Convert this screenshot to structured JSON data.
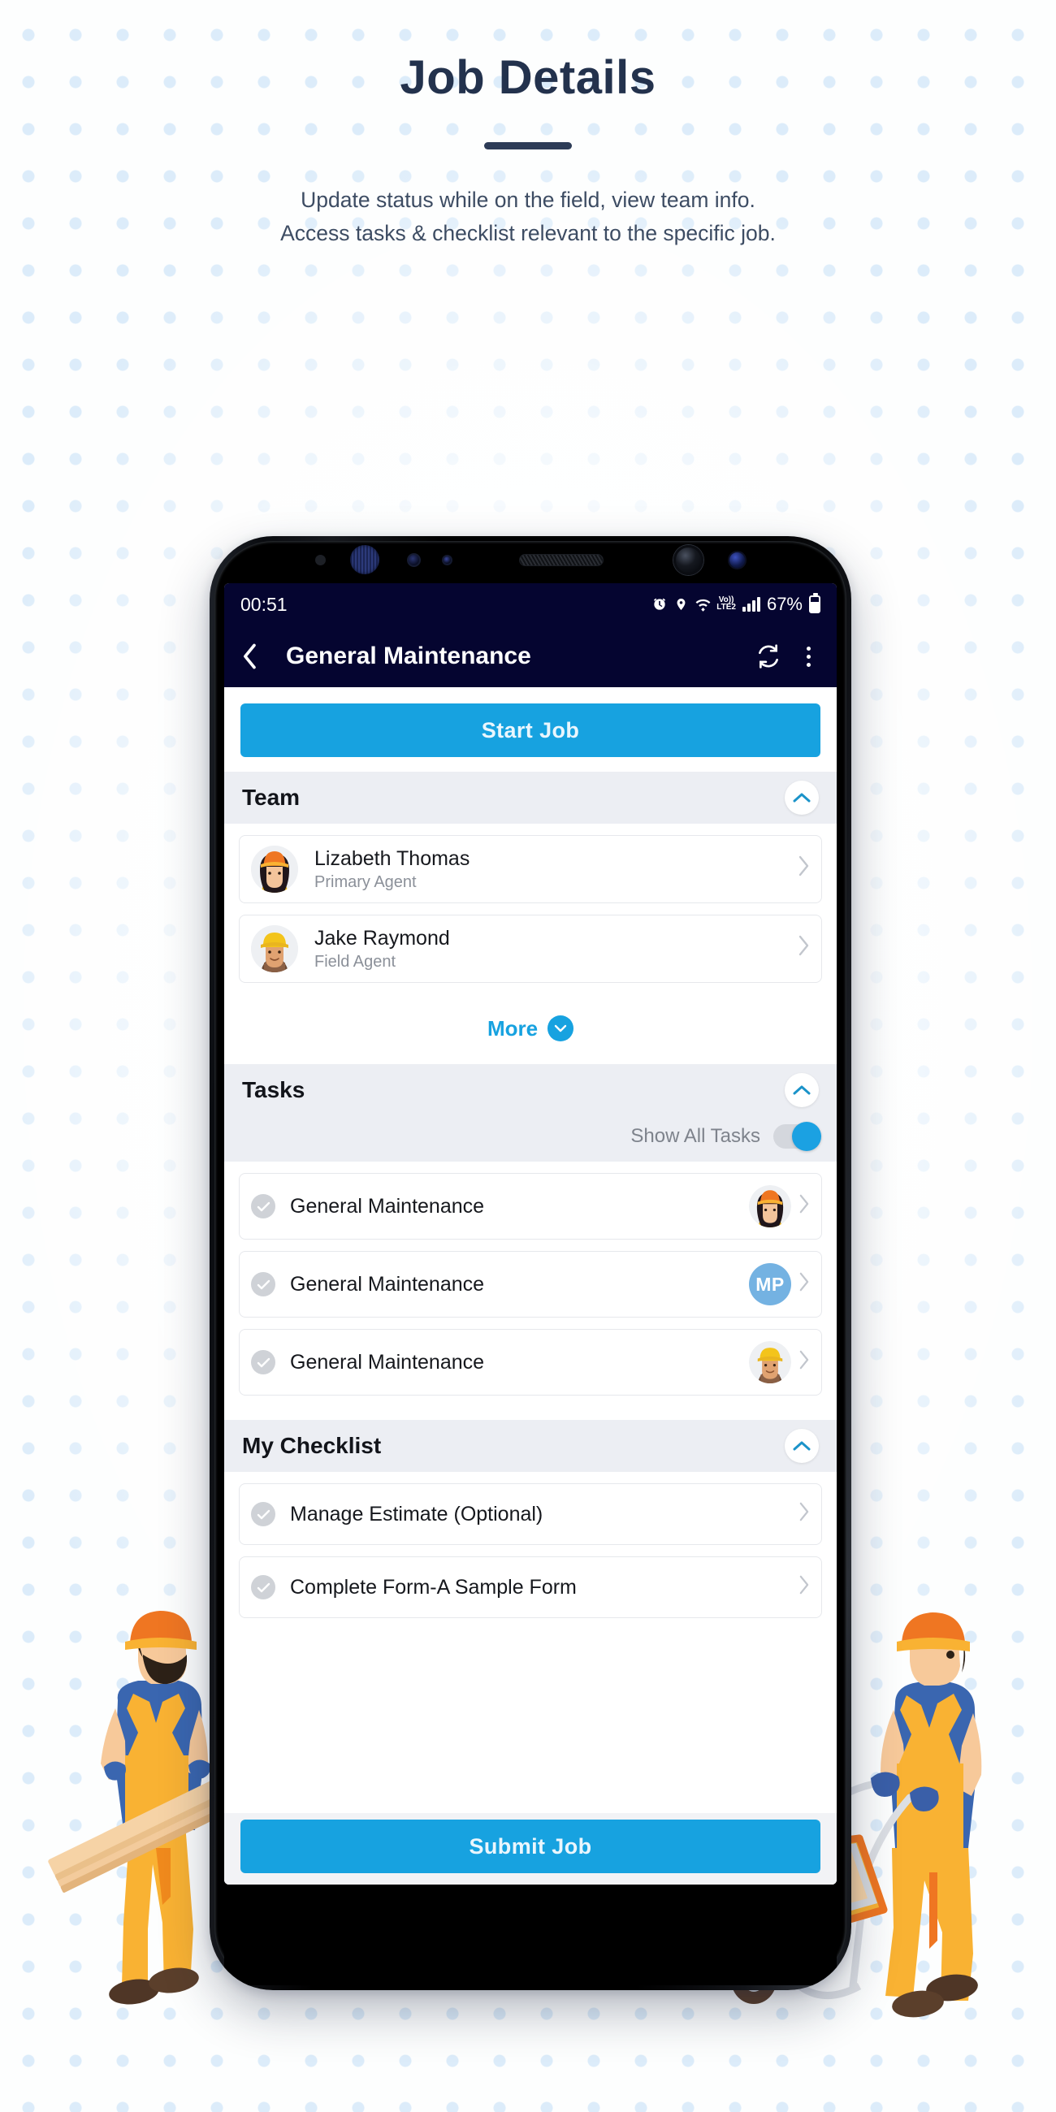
{
  "hero": {
    "title": "Job Details",
    "subtitle_line1": "Update status while on the field, view team info.",
    "subtitle_line2": "Access tasks & checklist relevant to the specific job."
  },
  "colors": {
    "accent_blue": "#17a2e0",
    "header_navy": "#050530",
    "title_navy": "#23324d",
    "dot_blue": "#dcecfa",
    "section_grey": "#eceef3",
    "initials_avatar": "#74b2e2"
  },
  "phone": {
    "status_bar": {
      "time": "00:51",
      "network_label": "LTE2",
      "volte_label": "Vo))",
      "battery_percent": "67%",
      "icons": [
        "alarm-icon",
        "location-icon",
        "wifi-icon",
        "volte-icon",
        "signal-bars-icon",
        "battery-icon"
      ]
    },
    "app_bar": {
      "back_icon": "chevron-left-icon",
      "title": "General Maintenance",
      "refresh_icon": "refresh-icon",
      "overflow_icon": "kebab-menu-icon"
    },
    "start_job_label": "Start Job",
    "submit_job_label": "Submit Job",
    "sections": [
      {
        "id": "team",
        "title": "Team",
        "collapse_icon": "chevron-up-icon",
        "members": [
          {
            "name": "Lizabeth Thomas",
            "role": "Primary Agent",
            "avatar": "photo-female-orange-helmet"
          },
          {
            "name": "Jake Raymond",
            "role": "Field Agent",
            "avatar": "photo-male-yellow-helmet"
          }
        ],
        "more_label": "More",
        "more_icon": "chevron-down-circle-icon"
      },
      {
        "id": "tasks",
        "title": "Tasks",
        "collapse_icon": "chevron-up-icon",
        "toggle_label": "Show All Tasks",
        "toggle_on": true,
        "items": [
          {
            "label": "General Maintenance",
            "status_icon": "check-circle-icon",
            "avatar_type": "photo",
            "avatar": "photo-female-orange-helmet",
            "initials": ""
          },
          {
            "label": "General Maintenance",
            "status_icon": "check-circle-icon",
            "avatar_type": "initials",
            "avatar": "",
            "initials": "MP"
          },
          {
            "label": "General Maintenance",
            "status_icon": "check-circle-icon",
            "avatar_type": "photo",
            "avatar": "photo-male-yellow-helmet",
            "initials": ""
          }
        ]
      },
      {
        "id": "checklist",
        "title": "My Checklist",
        "collapse_icon": "chevron-up-icon",
        "items": [
          {
            "label": "Manage Estimate (Optional)",
            "status_icon": "check-circle-icon"
          },
          {
            "label": "Complete Form-A Sample Form",
            "status_icon": "check-circle-icon"
          }
        ]
      }
    ]
  },
  "illustrations": {
    "left": "worker-carrying-planks",
    "right": "worker-pushing-wheelbarrow"
  }
}
